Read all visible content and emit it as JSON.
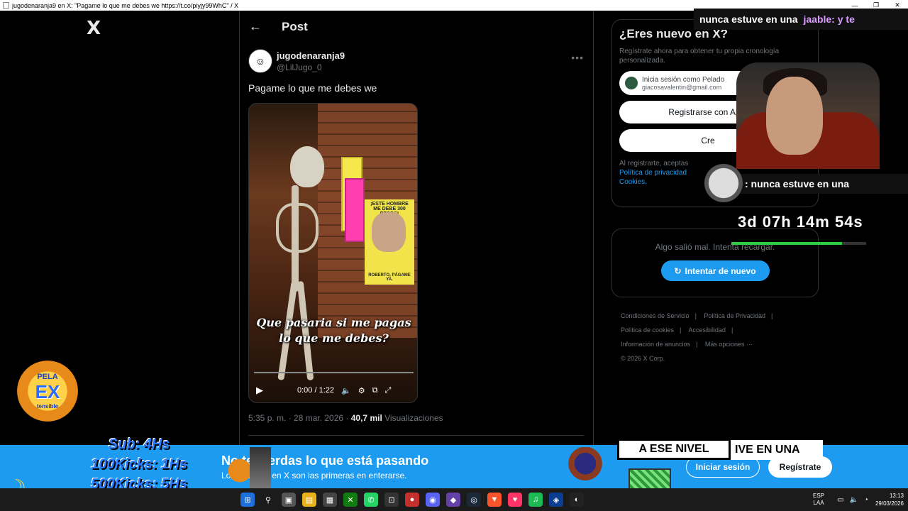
{
  "window": {
    "title": "jugodenaranja9 en X: \"Pagame lo que me debes we https://t.co/piyjy99WhC\" / X"
  },
  "nav": {
    "logo": "X"
  },
  "header": {
    "back_icon": "arrow-left-icon",
    "title": "Post"
  },
  "tweet": {
    "author_name": "jugodenaranja9",
    "author_handle": "@LilJugo_0",
    "text": "Pagame lo que me debes we",
    "video": {
      "poster_text": "¡ESTE HOMBRE ME DEBE 300 PESOS!",
      "poster_caption": "ROBERTO, PÁGAME YA.",
      "caption": "Que pasaria si me pagas lo que me debes?",
      "time": "0:00 / 1:22"
    },
    "timestamp": "5:35 p. m. · 28 mar. 2026 ·",
    "views_count": "40,7 mil",
    "views_label": "Visualizaciones"
  },
  "signup": {
    "title": "¿Eres nuevo en X?",
    "subtitle": "Regístrate ahora para obtener tu propia cronología personalizada.",
    "google_label": "Inicia sesión como Pelado",
    "google_email": "giacosavalentin@gmail.com",
    "apple_label": "Registrarse con Apple",
    "create_label": "Cre",
    "terms_prefix": "Al registrarte, aceptas",
    "terms_link1": "Política de privacidad",
    "terms_link2": "Cookies."
  },
  "error_card": {
    "text": "Algo salió mal. Intenta recargar.",
    "retry_label": "Intentar de nuevo"
  },
  "footer": {
    "links": [
      "Condiciones de Servicio",
      "Política de Privacidad",
      "Política de cookies",
      "Accesibilidad",
      "Información de anuncios",
      "Más opciones ···",
      "© 2026 X Corp."
    ]
  },
  "stream_overlay": {
    "chat_top_msg": "nunca estuve en una",
    "chat_top_user": "jaable: y te",
    "chat_mid_msg": ": nunca estuve en una",
    "countdown": "3d 07h 14m 54s",
    "countdown_progress": 0.82,
    "badge_l1": "PELA",
    "badge_l2": "EX",
    "badge_l3": "tensible",
    "goals": [
      "Sub: 4Hs",
      "100Kicks: 1Hs",
      "500Kicks: 5Hs"
    ],
    "ese_nivel": "A ESE NIVEL",
    "ive_text": "IVE EN UNA"
  },
  "banner": {
    "title": "No te pierdas lo que está pasando",
    "subtitle": "Los usuarios en X son las primeras en enterarse.",
    "login_label": "Iniciar sesión",
    "signup_label": "Regístrate"
  },
  "taskbar": {
    "lang1": "ESP",
    "lang2": "LAA",
    "time": "13:13",
    "date": "29/03/2026"
  }
}
